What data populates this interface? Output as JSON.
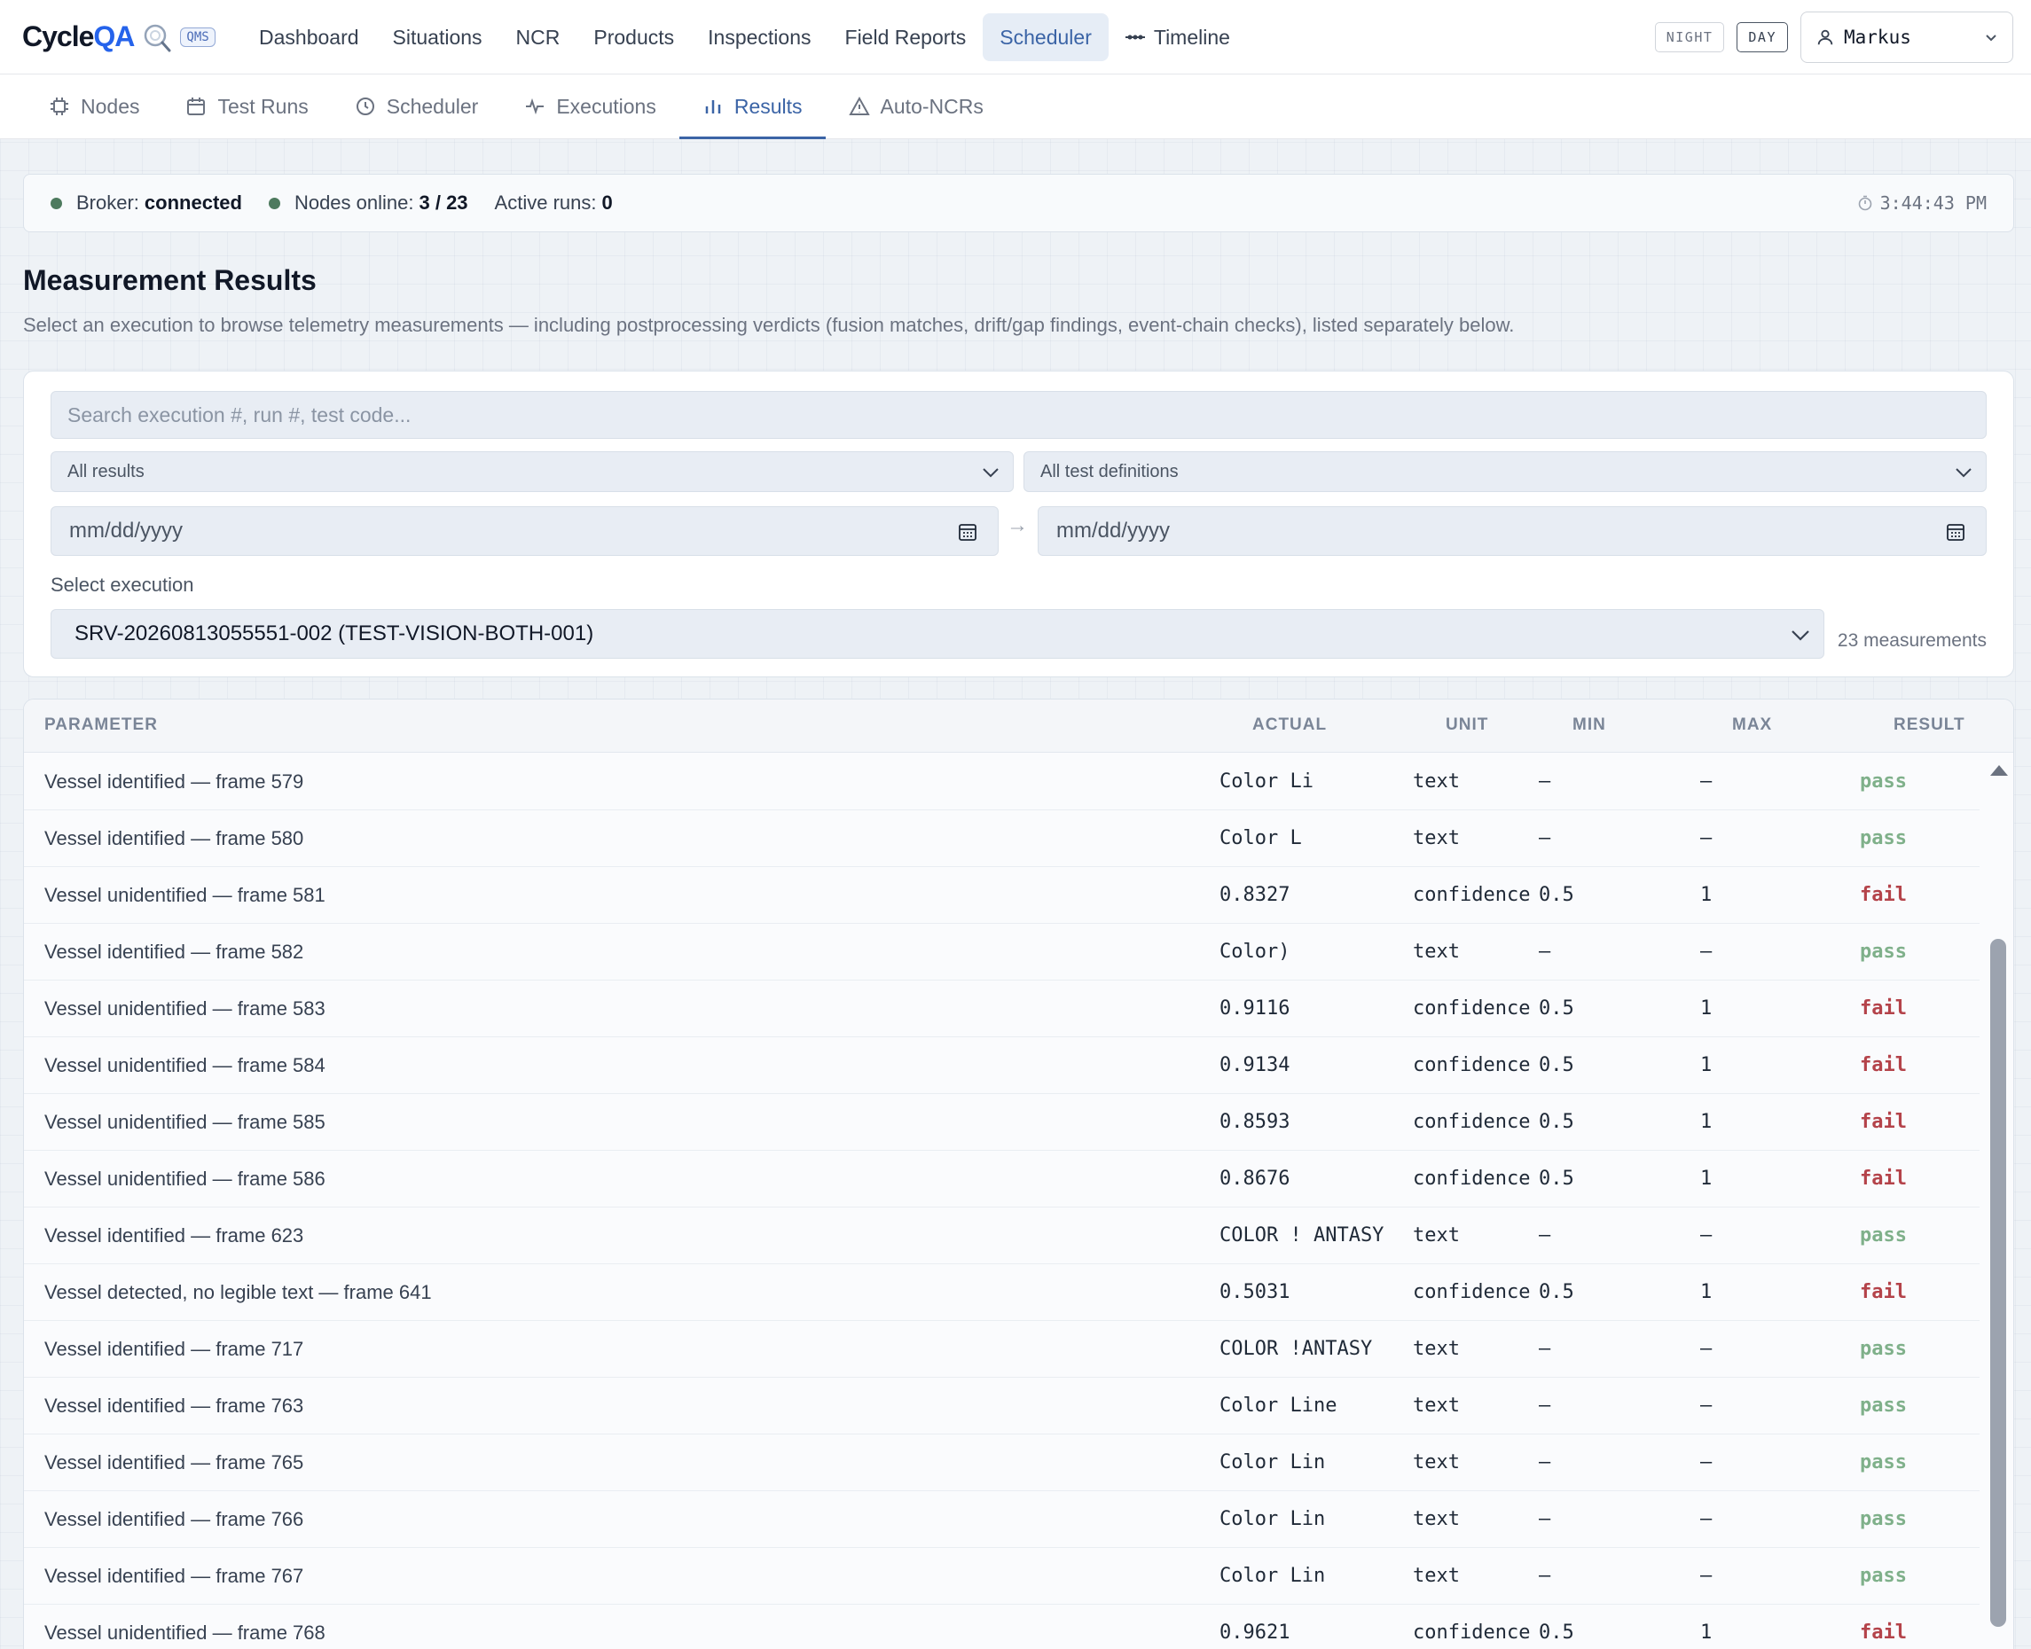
{
  "brand": {
    "name_prefix": "Cycle",
    "name_suffix": "QA",
    "badge": "QMS"
  },
  "nav": [
    {
      "label": "Dashboard"
    },
    {
      "label": "Situations"
    },
    {
      "label": "NCR"
    },
    {
      "label": "Products"
    },
    {
      "label": "Inspections"
    },
    {
      "label": "Field Reports"
    },
    {
      "label": "Scheduler",
      "active": true
    },
    {
      "label": "Timeline"
    }
  ],
  "modes": {
    "night": "NIGHT",
    "day": "DAY"
  },
  "user": {
    "name": "Markus"
  },
  "subnav": [
    {
      "label": "Nodes",
      "icon": "chip-icon"
    },
    {
      "label": "Test Runs",
      "icon": "calendar-icon"
    },
    {
      "label": "Scheduler",
      "icon": "clock-icon"
    },
    {
      "label": "Executions",
      "icon": "activity-icon"
    },
    {
      "label": "Results",
      "icon": "bar-chart-icon",
      "active": true
    },
    {
      "label": "Auto-NCRs",
      "icon": "warning-icon"
    }
  ],
  "status": {
    "broker_label": "Broker:",
    "broker_value": "connected",
    "nodes_label": "Nodes online:",
    "nodes_value": "3 / 23",
    "runs_label": "Active runs:",
    "runs_value": "0",
    "time": "3:44:43 PM",
    "dot_color": "#4d7a5e"
  },
  "page": {
    "title": "Measurement Results",
    "subtitle": "Select an execution to browse telemetry measurements — including postprocessing verdicts (fusion matches, drift/gap findings, event-chain checks), listed separately below."
  },
  "filters": {
    "search_placeholder": "Search execution #, run #, test code...",
    "results_select": "All results",
    "definitions_select": "All test definitions",
    "date_from": "mm/dd/yyyy",
    "date_to": "mm/dd/yyyy",
    "date_arrow": "→",
    "execution_label": "Select execution",
    "execution_value": "SRV-20260813055551-002 (TEST-VISION-BOTH-001)",
    "measurement_count": "23 measurements"
  },
  "table": {
    "headers": {
      "parameter": "PARAMETER",
      "actual": "ACTUAL",
      "unit": "UNIT",
      "min": "MIN",
      "max": "MAX",
      "result": "RESULT"
    },
    "rows": [
      {
        "parameter": "Vessel identified — frame 579",
        "actual": "Color Li",
        "unit": "text",
        "min": "—",
        "max": "—",
        "result": "pass"
      },
      {
        "parameter": "Vessel identified — frame 580",
        "actual": "Color L",
        "unit": "text",
        "min": "—",
        "max": "—",
        "result": "pass"
      },
      {
        "parameter": "Vessel unidentified — frame 581",
        "actual": "0.8327",
        "unit": "confidence",
        "min": "0.5",
        "max": "1",
        "result": "fail"
      },
      {
        "parameter": "Vessel identified — frame 582",
        "actual": "Color)",
        "unit": "text",
        "min": "—",
        "max": "—",
        "result": "pass"
      },
      {
        "parameter": "Vessel unidentified — frame 583",
        "actual": "0.9116",
        "unit": "confidence",
        "min": "0.5",
        "max": "1",
        "result": "fail"
      },
      {
        "parameter": "Vessel unidentified — frame 584",
        "actual": "0.9134",
        "unit": "confidence",
        "min": "0.5",
        "max": "1",
        "result": "fail"
      },
      {
        "parameter": "Vessel unidentified — frame 585",
        "actual": "0.8593",
        "unit": "confidence",
        "min": "0.5",
        "max": "1",
        "result": "fail"
      },
      {
        "parameter": "Vessel unidentified — frame 586",
        "actual": "0.8676",
        "unit": "confidence",
        "min": "0.5",
        "max": "1",
        "result": "fail"
      },
      {
        "parameter": "Vessel identified — frame 623",
        "actual": "COLOR ! ANTASY",
        "unit": "text",
        "min": "—",
        "max": "—",
        "result": "pass"
      },
      {
        "parameter": "Vessel detected, no legible text — frame 641",
        "actual": "0.5031",
        "unit": "confidence",
        "min": "0.5",
        "max": "1",
        "result": "fail"
      },
      {
        "parameter": "Vessel identified — frame 717",
        "actual": "COLOR !ANTASY",
        "unit": "text",
        "min": "—",
        "max": "—",
        "result": "pass"
      },
      {
        "parameter": "Vessel identified — frame 763",
        "actual": "Color Line",
        "unit": "text",
        "min": "—",
        "max": "—",
        "result": "pass"
      },
      {
        "parameter": "Vessel identified — frame 765",
        "actual": "Color Lin",
        "unit": "text",
        "min": "—",
        "max": "—",
        "result": "pass"
      },
      {
        "parameter": "Vessel identified — frame 766",
        "actual": "Color Lin",
        "unit": "text",
        "min": "—",
        "max": "—",
        "result": "pass"
      },
      {
        "parameter": "Vessel identified — frame 767",
        "actual": "Color Lin",
        "unit": "text",
        "min": "—",
        "max": "—",
        "result": "pass"
      },
      {
        "parameter": "Vessel unidentified — frame 768",
        "actual": "0.9621",
        "unit": "confidence",
        "min": "0.5",
        "max": "1",
        "result": "fail"
      }
    ],
    "colors": {
      "pass": "#7fb08a",
      "fail": "#b4434a"
    }
  }
}
